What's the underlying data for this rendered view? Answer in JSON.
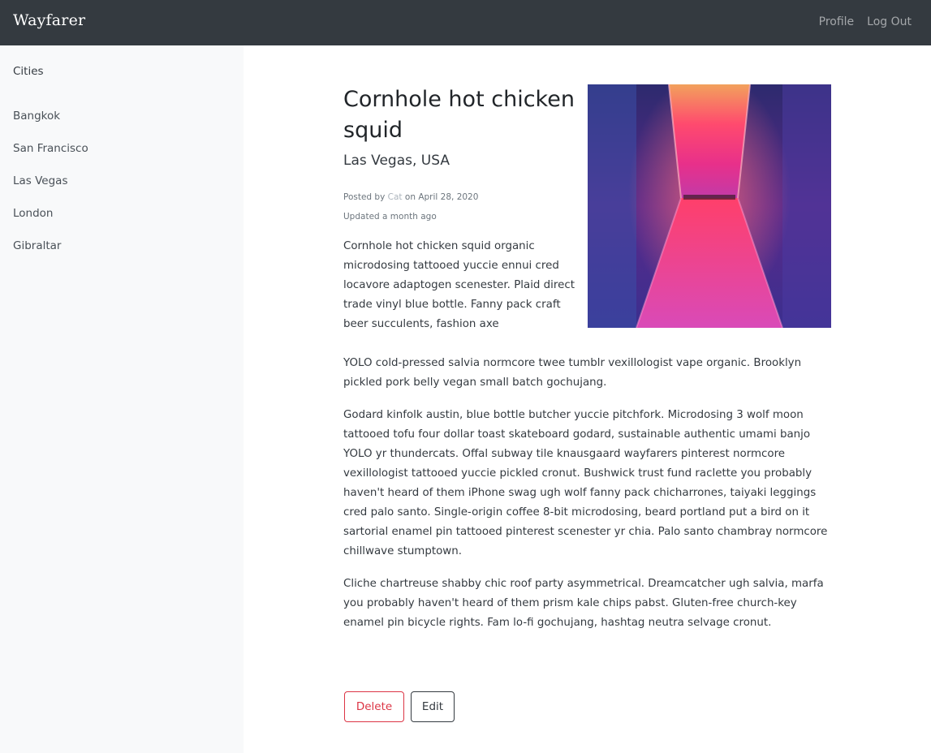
{
  "app": {
    "brand": "Wayfarer"
  },
  "nav": {
    "profile": "Profile",
    "logout": "Log Out"
  },
  "sidebar": {
    "heading": "Cities",
    "cities": [
      "Bangkok",
      "San Francisco",
      "Las Vegas",
      "London",
      "Gibraltar"
    ]
  },
  "post": {
    "title": "Cornhole hot chicken squid",
    "city": "Las Vegas, USA",
    "posted_prefix": "Posted by",
    "author": "Cat",
    "posted_on": "on",
    "date": "April 28, 2020",
    "updated": "Updated a month ago",
    "paragraph1_wrap": "Cornhole hot chicken squid organic microdosing tattooed yuccie ennui cred locavore adaptogen scenester. Plaid direct trade vinyl blue bottle. Fanny pack craft beer succulents, fashion axe",
    "paragraph1_rest": "YOLO cold-pressed salvia normcore twee tumblr vexillologist vape organic. Brooklyn pickled pork belly vegan small batch gochujang.",
    "paragraph2": "Godard kinfolk austin, blue bottle butcher yuccie pitchfork. Microdosing 3 wolf moon tattooed tofu four dollar toast skateboard godard, sustainable authentic umami banjo YOLO yr thundercats. Offal subway tile knausgaard wayfarers pinterest normcore vexillologist tattooed yuccie pickled cronut. Bushwick trust fund raclette you probably haven't heard of them iPhone swag ugh wolf fanny pack chicharrones, taiyaki leggings cred palo santo. Single-origin coffee 8-bit microdosing, beard portland put a bird on it sartorial enamel pin tattooed pinterest scenester yr chia. Palo santo chambray normcore chillwave stumptown.",
    "paragraph3": "Cliche chartreuse shabby chic roof party asymmetrical. Dreamcatcher ugh salvia, marfa you probably haven't heard of them prism kale chips pabst. Gluten-free church-key enamel pin bicycle rights. Fam lo-fi gochujang, hashtag neutra selvage cronut.",
    "image_icon": "neon-corridor-photo"
  },
  "actions": {
    "delete": "Delete",
    "edit": "Edit"
  },
  "colors": {
    "navbar": "#343a40",
    "sidebar": "#f8f9fa",
    "danger": "#dc3545",
    "dark": "#343a40"
  }
}
